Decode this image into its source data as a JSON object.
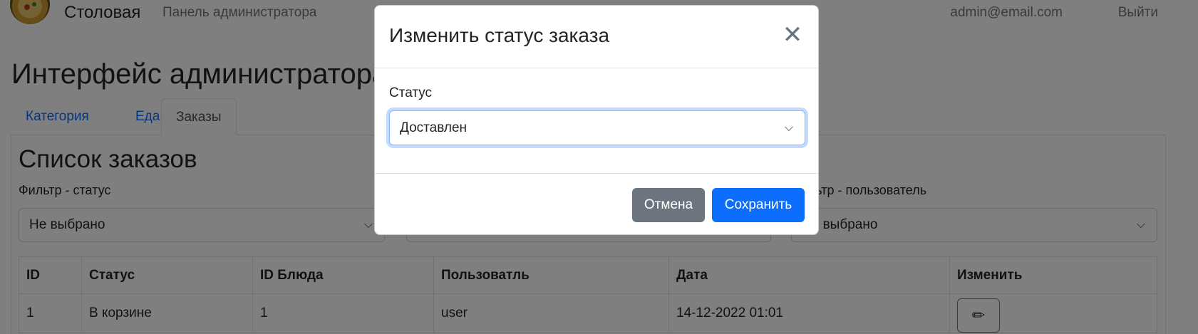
{
  "navbar": {
    "brand": "Столовая",
    "admin_panel": "Панель администратора",
    "email": "admin@email.com",
    "logout": "Выйти"
  },
  "page": {
    "title": "Интерфейс администратора",
    "tabs": [
      "Категория",
      "Еда",
      "Заказы"
    ],
    "active_tab": "Заказы"
  },
  "orders": {
    "title": "Список заказов",
    "filters": [
      {
        "label": "Фильтр - статус",
        "value": "Не выбрано"
      },
      {
        "label": "",
        "value": ""
      },
      {
        "label": "Фильтр - пользователь",
        "value": "Не выбрано"
      }
    ],
    "columns": [
      "ID",
      "Статус",
      "ID Блюда",
      "Пользоватль",
      "Дата",
      "Изменить"
    ],
    "rows": [
      {
        "id": "1",
        "status": "В корзине",
        "dish_id": "1",
        "user": "user",
        "date": "14-12-2022 01:01",
        "edit_icon": "pencil-icon"
      }
    ]
  },
  "modal": {
    "title": "Изменить статус заказа",
    "close_icon": "close-icon",
    "field_label": "Статус",
    "selected_status": "Доставлен",
    "cancel": "Отмена",
    "save": "Сохранить"
  },
  "colors": {
    "primary": "#0d6efd",
    "secondary": "#6c757d",
    "backdrop": "rgba(0,0,0,0.5)"
  }
}
